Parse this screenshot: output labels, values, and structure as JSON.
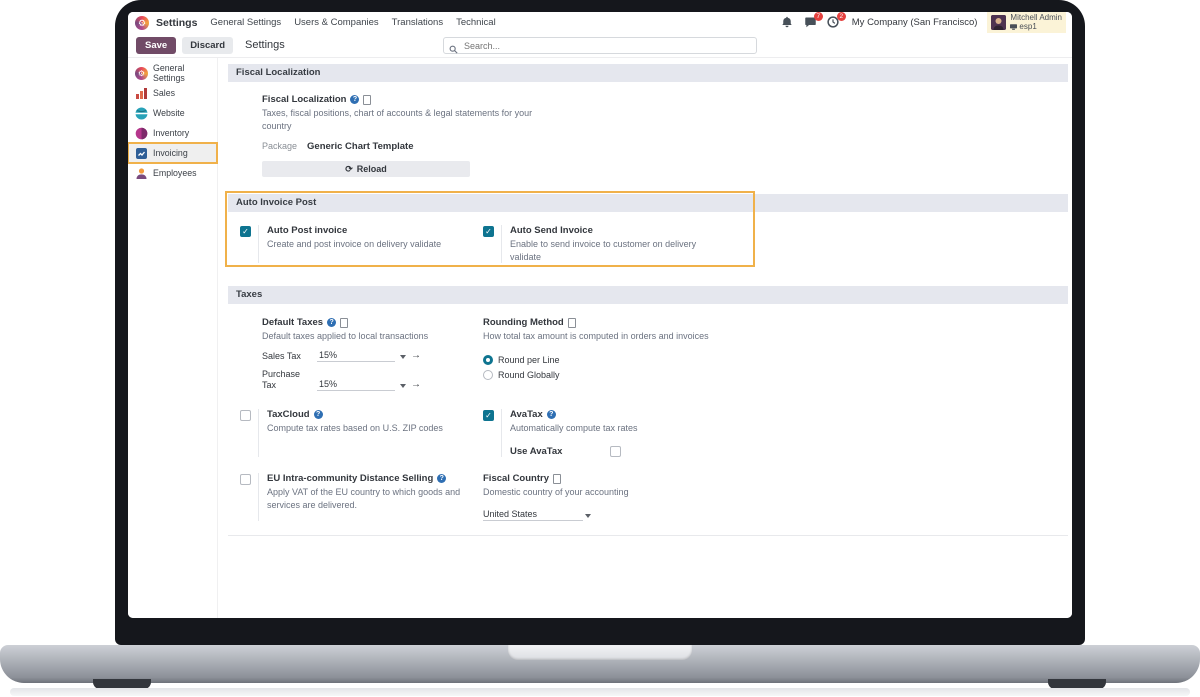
{
  "app": {
    "name": "Settings",
    "menus": [
      "General Settings",
      "Users & Companies",
      "Translations",
      "Technical"
    ]
  },
  "systray": {
    "messages_badge": "7",
    "activities_badge": "2",
    "company": "My Company (San Francisco)",
    "user_name": "Mitchell Admin",
    "user_env": "esp1"
  },
  "control_panel": {
    "save_label": "Save",
    "discard_label": "Discard",
    "breadcrumb": "Settings",
    "search_placeholder": "Search..."
  },
  "sidebar": {
    "items": [
      {
        "label": "General Settings",
        "icon": "gear-icon",
        "selected": false
      },
      {
        "label": "Sales",
        "icon": "bar-chart-icon",
        "selected": false
      },
      {
        "label": "Website",
        "icon": "globe-icon",
        "selected": false
      },
      {
        "label": "Inventory",
        "icon": "inventory-icon",
        "selected": false
      },
      {
        "label": "Invoicing",
        "icon": "invoicing-icon",
        "selected": true
      },
      {
        "label": "Employees",
        "icon": "employees-icon",
        "selected": false
      }
    ]
  },
  "fiscal_localization": {
    "header": "Fiscal Localization",
    "title": "Fiscal Localization",
    "description": "Taxes, fiscal positions, chart of accounts & legal statements for your country",
    "package_label": "Package",
    "package_value": "Generic Chart Template",
    "reload_label": "Reload"
  },
  "auto_invoice_post": {
    "header": "Auto Invoice Post",
    "options": [
      {
        "label": "Auto Post invoice",
        "description": "Create and post invoice on delivery validate",
        "checked": true
      },
      {
        "label": "Auto Send Invoice",
        "description": "Enable to send invoice to customer on delivery validate",
        "checked": true
      }
    ]
  },
  "taxes": {
    "header": "Taxes",
    "default_taxes": {
      "title": "Default Taxes",
      "description": "Default taxes applied to local transactions",
      "sales_tax_label": "Sales Tax",
      "sales_tax_value": "15%",
      "purchase_tax_label": "Purchase Tax",
      "purchase_tax_value": "15%"
    },
    "rounding_method": {
      "title": "Rounding Method",
      "description": "How total tax amount is computed in orders and invoices",
      "option_round_per_line": "Round per Line",
      "option_round_globally": "Round Globally",
      "selected": "Round per Line"
    },
    "taxcloud": {
      "title": "TaxCloud",
      "description": "Compute tax rates based on U.S. ZIP codes",
      "checked": false
    },
    "avatax": {
      "title": "AvaTax",
      "description": "Automatically compute tax rates",
      "checked": true,
      "use_avatax_label": "Use AvaTax",
      "use_avatax_checked": false
    },
    "eu_distance_selling": {
      "title": "EU Intra-community Distance Selling",
      "description": "Apply VAT of the EU country to which goods and services are delivered.",
      "checked": false
    },
    "fiscal_country": {
      "title": "Fiscal Country",
      "description": "Domestic country of your accounting",
      "value": "United States"
    }
  },
  "colors": {
    "primary": "#714B67",
    "highlight_border": "#F0B14A",
    "checked_control": "#0E7490",
    "badge": "#E4413F",
    "section_header_bg": "#E5E7EE"
  }
}
